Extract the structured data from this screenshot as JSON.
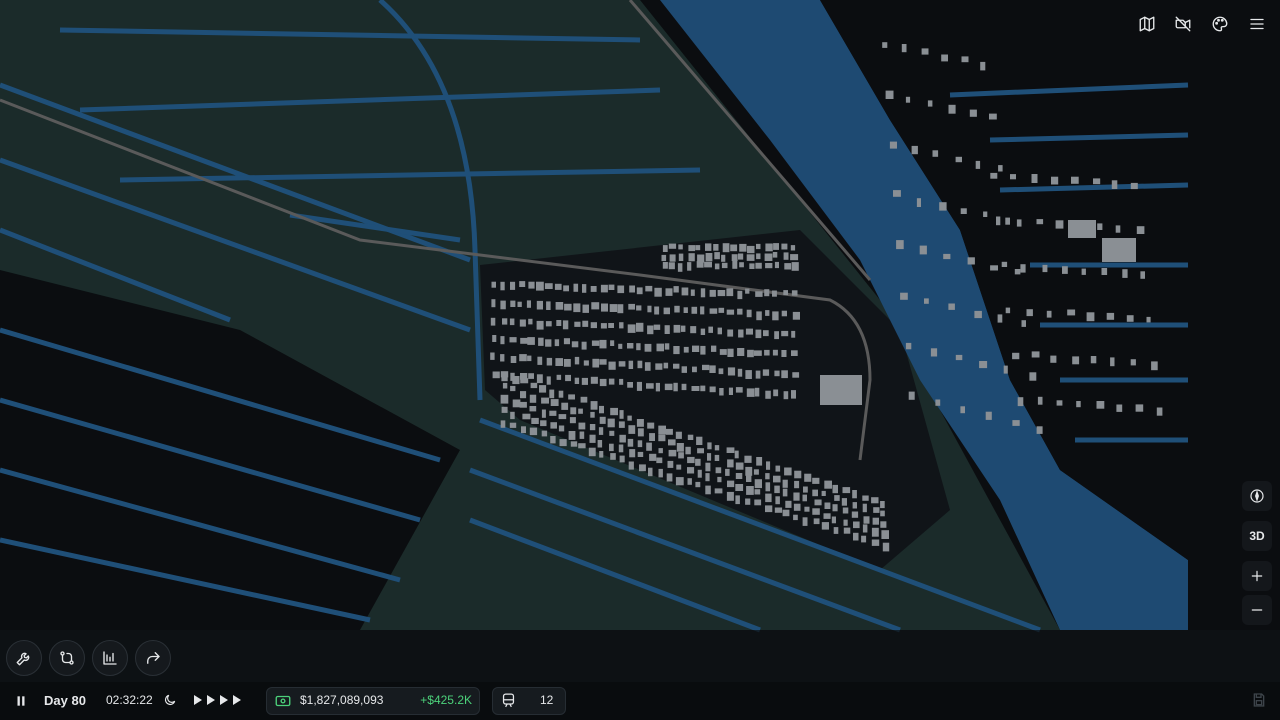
{
  "top_toolbar": {
    "buttons": [
      {
        "name": "map-icon",
        "title": "Map"
      },
      {
        "name": "camera-off-icon",
        "title": "Muted"
      },
      {
        "name": "palette-icon",
        "title": "Theme"
      },
      {
        "name": "menu-icon",
        "title": "Menu"
      }
    ]
  },
  "map_controls": {
    "compass": "compass-icon",
    "view_toggle": "3D",
    "zoom_in": "plus-icon",
    "zoom_out": "minus-icon"
  },
  "tools": [
    {
      "name": "wrench-icon"
    },
    {
      "name": "route-icon"
    },
    {
      "name": "chart-icon"
    },
    {
      "name": "share-icon"
    }
  ],
  "status_bar": {
    "pause_icon": "pause-icon",
    "day": "Day 80",
    "time": "02:32:22",
    "night_icon": "moon-icon",
    "speed_icon": "fast-forward-icon",
    "money": "$1,827,089,093",
    "income": "+$425.2K",
    "trains": "12",
    "save_icon": "save-icon"
  },
  "colors": {
    "background": "#0b0d10",
    "land": "#1b2b2a",
    "water": "#1f4f78",
    "river": "#1e4a72",
    "building": "#8a8f94",
    "income": "#4cd17a",
    "money_icon": "#4cd17a"
  }
}
